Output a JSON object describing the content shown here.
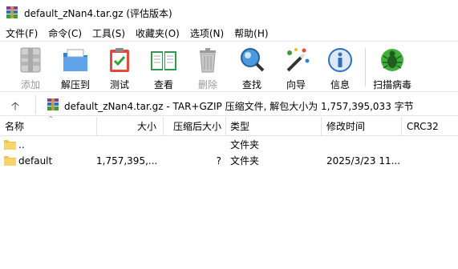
{
  "window": {
    "title": "default_zNan4.tar.gz (评估版本)"
  },
  "menu": [
    "文件(F)",
    "命令(C)",
    "工具(S)",
    "收藏夹(O)",
    "选项(N)",
    "帮助(H)"
  ],
  "toolbar": {
    "add": "添加",
    "extract": "解压到",
    "test": "测试",
    "view": "查看",
    "delete": "删除",
    "find": "查找",
    "wizard": "向导",
    "info": "信息",
    "virus_scan": "扫描病毒"
  },
  "pathbar": {
    "up_arrow": "🡡",
    "text": "default_zNan4.tar.gz - TAR+GZIP 压缩文件, 解包大小为 1,757,395,033 字节"
  },
  "columns": {
    "name": "名称",
    "size": "大小",
    "packed": "压缩后大小",
    "type": "类型",
    "modified": "修改时间",
    "crc": "CRC32"
  },
  "rows": [
    {
      "name": "..",
      "size": "",
      "packed": "",
      "type": "文件夹",
      "modified": "",
      "crc": ""
    },
    {
      "name": "default",
      "size": "1,757,395,...",
      "packed": "?",
      "type": "文件夹",
      "modified": "2025/3/23 11...",
      "crc": ""
    }
  ],
  "colors": {
    "folder": "#f5c542",
    "accent_blue": "#2f7fd8",
    "virus_green": "#3fae3a"
  }
}
